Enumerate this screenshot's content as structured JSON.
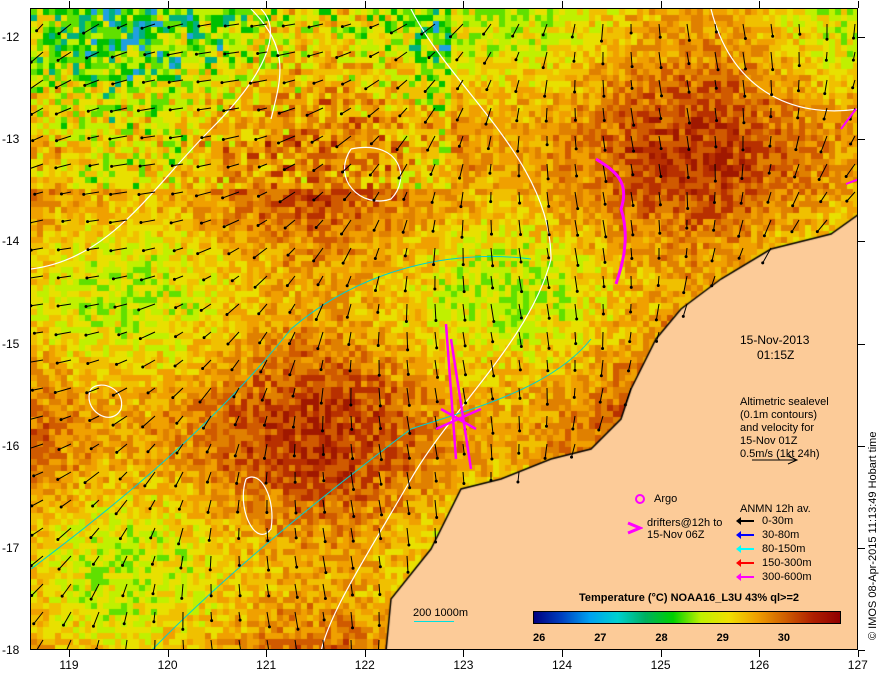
{
  "map": {
    "x_ticks": [
      "119",
      "120",
      "121",
      "122",
      "123",
      "124",
      "125",
      "126",
      "127"
    ],
    "y_ticks": [
      "-12",
      "-13",
      "-14",
      "-15",
      "-16",
      "-17",
      "-18"
    ],
    "lon_range": [
      118.6,
      127
    ],
    "lat_range": [
      -18,
      -11.7
    ]
  },
  "info": {
    "date": "15-Nov-2013",
    "time": "01:15Z",
    "altimetry": [
      "Altimetric sealevel",
      "(0.1m contours)",
      "and velocity for",
      "15-Nov 01Z",
      "0.5m/s (1kt 24h)"
    ],
    "argo": "Argo",
    "drifters": [
      "drifters@12h to",
      "15-Nov 06Z"
    ],
    "bathy": "200  1000m"
  },
  "anmn": {
    "title": "ANMN 12h av.",
    "items": [
      {
        "label": "0-30m",
        "color": "#000000"
      },
      {
        "label": "30-80m",
        "color": "#0000ff"
      },
      {
        "label": "80-150m",
        "color": "#00ffff"
      },
      {
        "label": "150-300m",
        "color": "#ff0000"
      },
      {
        "label": "300-600m",
        "color": "#ff00ff"
      }
    ]
  },
  "colorbar": {
    "title": "Temperature (°C) NOAA16_L3U 43% ql>=2",
    "labels": [
      "26",
      "27",
      "28",
      "29",
      "30"
    ],
    "range": [
      25.9,
      30.9
    ]
  },
  "credit": "© IMOS 08-Apr-2015 11:13:49 Hobart time",
  "colors": {
    "land": "#fccb98",
    "argo": "#ff00ff"
  }
}
